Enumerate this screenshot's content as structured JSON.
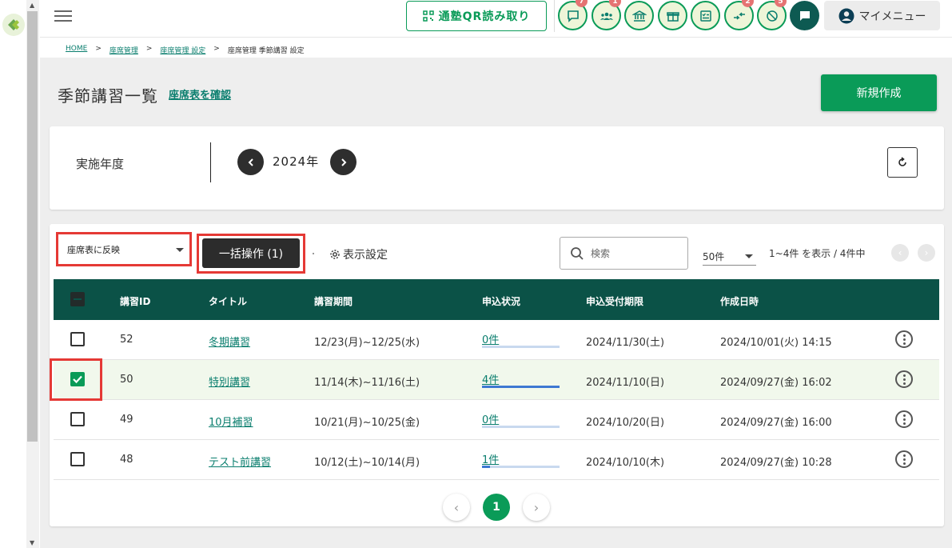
{
  "header": {
    "qr_label": "通塾QR読み取り",
    "badges": {
      "messages": "7",
      "students": "1",
      "gift": "",
      "swap": "2",
      "alert": "5"
    },
    "mymenu_label": "マイメニュー"
  },
  "breadcrumb": {
    "home": "HOME",
    "seat_mgmt": "座席管理",
    "seat_settings": "座席管理 設定",
    "current": "座席管理 季節講習 設定"
  },
  "page": {
    "title": "季節講習一覧",
    "seat_link": "座席表を確認",
    "new_button": "新規作成"
  },
  "year_filter": {
    "label": "実施年度",
    "value": "2024年"
  },
  "toolbar": {
    "bulk_select": "座席表に反映",
    "bulk_button": "一括操作 (1)",
    "display_settings": "表示設定",
    "search_placeholder": "検索",
    "per_page": "50件",
    "range_text": "1~4件 を表示 / 4件中"
  },
  "table": {
    "columns": [
      "講習ID",
      "タイトル",
      "講習期間",
      "申込状況",
      "申込受付期限",
      "作成日時"
    ],
    "rows": [
      {
        "id": "52",
        "title": "冬期講習",
        "period": "12/23(月)~12/25(水)",
        "applications": "0件",
        "fill": 0,
        "deadline": "2024/11/30(土)",
        "created": "2024/10/01(火) 14:15",
        "checked": false
      },
      {
        "id": "50",
        "title": "特別講習",
        "period": "11/14(木)~11/16(土)",
        "applications": "4件",
        "fill": 1,
        "deadline": "2024/11/10(日)",
        "created": "2024/09/27(金) 16:02",
        "checked": true
      },
      {
        "id": "49",
        "title": "10月補習",
        "period": "10/21(月)~10/25(金)",
        "applications": "0件",
        "fill": 0,
        "deadline": "2024/10/20(日)",
        "created": "2024/09/27(金) 16:00",
        "checked": false
      },
      {
        "id": "48",
        "title": "テスト前講習",
        "period": "10/12(土)~10/14(月)",
        "applications": "1件",
        "fill": 0.1,
        "deadline": "2024/10/10(木)",
        "created": "2024/09/27(金) 10:28",
        "checked": false
      }
    ]
  },
  "pagination": {
    "current": "1"
  },
  "colors": {
    "primary": "#0a9b58",
    "header_dark": "#0b5247",
    "highlight": "#e53935",
    "link": "#0a7e6e"
  }
}
